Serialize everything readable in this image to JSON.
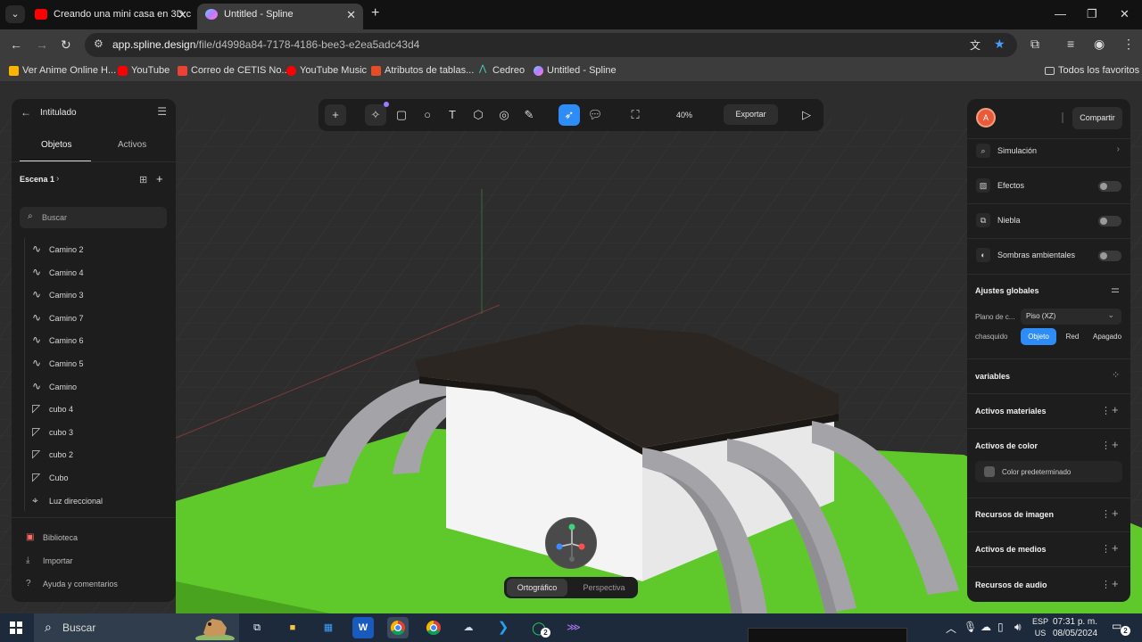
{
  "browser": {
    "tabs": [
      {
        "title": "Creando una mini casa en 3D c",
        "active": false
      },
      {
        "title": "Untitled - Spline",
        "active": true
      }
    ],
    "url_host": "app.spline.design",
    "url_path": "/file/d4998a84-7178-4186-bee3-e2ea5adc43d4",
    "bookmarks": [
      "Ver Anime Online H...",
      "YouTube",
      "Correo de CETIS No...",
      "YouTube Music",
      "Atributos de tablas...",
      "Cedreo",
      "Untitled - Spline"
    ],
    "all_bookmarks": "Todos los favoritos"
  },
  "left_panel": {
    "title": "Intitulado",
    "tabs": [
      "Objetos",
      "Activos"
    ],
    "scene": "Escena 1",
    "search_placeholder": "Buscar",
    "objects": [
      {
        "label": "Camino 2",
        "icon": "path-icon"
      },
      {
        "label": "Camino 4",
        "icon": "path-icon"
      },
      {
        "label": "Camino 3",
        "icon": "path-icon"
      },
      {
        "label": "Camino 7",
        "icon": "path-icon"
      },
      {
        "label": "Camino 6",
        "icon": "path-icon"
      },
      {
        "label": "Camino 5",
        "icon": "path-icon"
      },
      {
        "label": "Camino",
        "icon": "path-icon"
      },
      {
        "label": "cubo 4",
        "icon": "shape-icon"
      },
      {
        "label": "cubo 3",
        "icon": "shape-icon"
      },
      {
        "label": "cubo 2",
        "icon": "shape-icon"
      },
      {
        "label": "Cubo",
        "icon": "shape-icon"
      },
      {
        "label": "Luz direccional",
        "icon": "light-icon"
      }
    ],
    "footer": [
      "Biblioteca",
      "Importar",
      "Ayuda y comentarios"
    ]
  },
  "toolbar": {
    "zoom": "40%",
    "export": "Exportar"
  },
  "right_panel": {
    "avatar_initial": "A",
    "share": "Compartir",
    "rows": [
      {
        "label": "Simulación",
        "kind": "chevron"
      },
      {
        "label": "Efectos",
        "kind": "toggle"
      },
      {
        "label": "Niebla",
        "kind": "toggle"
      },
      {
        "label": "Sombras ambientales",
        "kind": "toggle"
      }
    ],
    "global_settings": "Ajustes globales",
    "plane_label": "Plano de c...",
    "plane_value": "Piso (XZ)",
    "snap_label": "chasquido",
    "snap_options": [
      "Objeto",
      "Red",
      "Apagado"
    ],
    "snap_selected": "Objeto",
    "variables": "variables",
    "material_assets": "Activos materiales",
    "color_assets": "Activos de color",
    "default_color": "Color predeterminado",
    "image_resources": "Recursos de imagen",
    "media_assets": "Activos de medios",
    "audio_resources": "Recursos de audio"
  },
  "viewport": {
    "projection": [
      "Ortográfico",
      "Perspectiva"
    ],
    "projection_selected": "Ortográfico"
  },
  "taskbar": {
    "search": "Buscar",
    "language": "ESP",
    "region": "US",
    "time": "07:31 p. m.",
    "date": "08/05/2024",
    "notifications": "2",
    "whatsapp_badge": "2"
  },
  "colors": {
    "accent": "#2e8cf7",
    "grass": "#5fc82a",
    "roof": "#2b2621",
    "wall": "#f2f2f2",
    "arch": "#a3a3a8"
  }
}
